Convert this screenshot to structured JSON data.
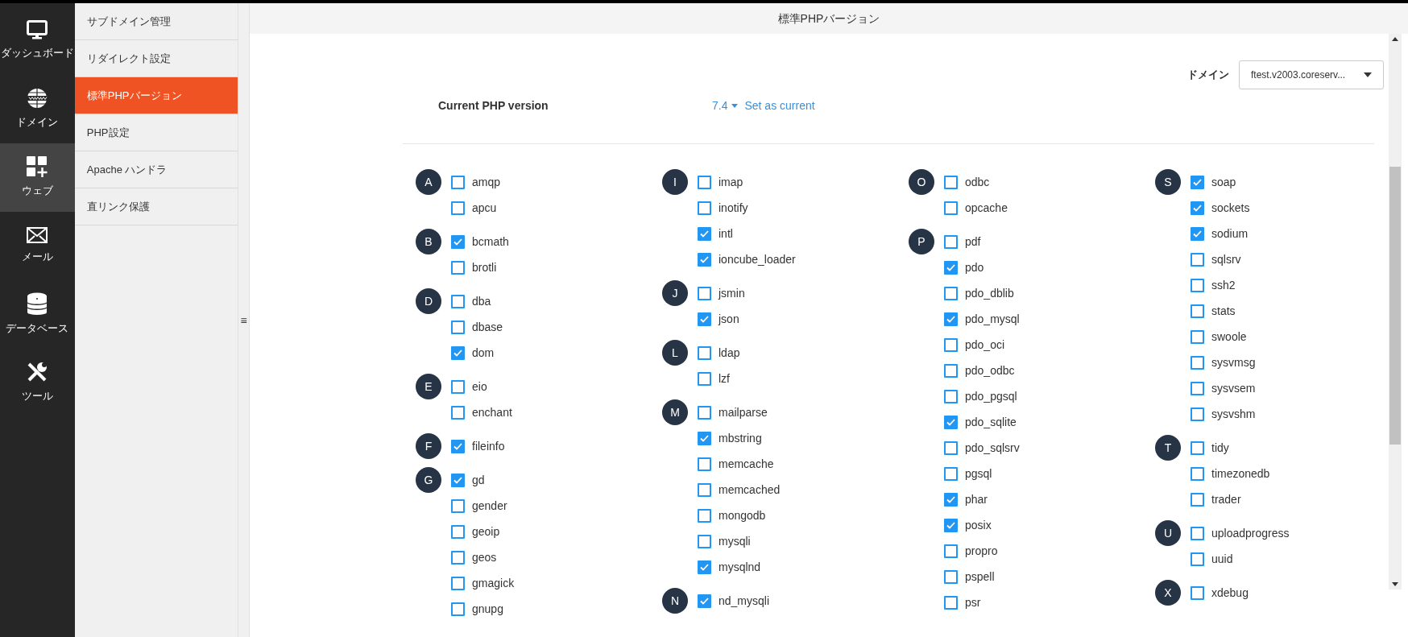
{
  "nav": [
    {
      "label": "ダッシュボード",
      "kind": "monitor",
      "selected": false
    },
    {
      "label": "ドメイン",
      "kind": "globe",
      "selected": false
    },
    {
      "label": "ウェブ",
      "kind": "grid",
      "selected": true
    },
    {
      "label": "メール",
      "kind": "mail",
      "selected": false
    },
    {
      "label": "データベース",
      "kind": "database",
      "selected": false
    },
    {
      "label": "ツール",
      "kind": "tools",
      "selected": false
    }
  ],
  "submenu": [
    {
      "label": "サブドメイン管理",
      "selected": false
    },
    {
      "label": "リダイレクト設定",
      "selected": false
    },
    {
      "label": "標準PHPバージョン",
      "selected": true
    },
    {
      "label": "PHP設定",
      "selected": false
    },
    {
      "label": "Apache ハンドラ",
      "selected": false
    },
    {
      "label": "直リンク保護",
      "selected": false
    }
  ],
  "collapse_handle": "≡",
  "page_title": "標準PHPバージョン",
  "domain": {
    "label": "ドメイン",
    "value": "ftest.v2003.coreserv..."
  },
  "php": {
    "label": "Current PHP version",
    "version": "7.4",
    "action": "Set as current"
  },
  "columns": [
    [
      {
        "letter": "A",
        "items": [
          {
            "name": "amqp",
            "checked": false
          },
          {
            "name": "apcu",
            "checked": false
          }
        ]
      },
      {
        "letter": "B",
        "items": [
          {
            "name": "bcmath",
            "checked": true
          },
          {
            "name": "brotli",
            "checked": false
          }
        ]
      },
      {
        "letter": "D",
        "items": [
          {
            "name": "dba",
            "checked": false
          },
          {
            "name": "dbase",
            "checked": false
          },
          {
            "name": "dom",
            "checked": true
          }
        ]
      },
      {
        "letter": "E",
        "items": [
          {
            "name": "eio",
            "checked": false
          },
          {
            "name": "enchant",
            "checked": false
          }
        ]
      },
      {
        "letter": "F",
        "items": [
          {
            "name": "fileinfo",
            "checked": true
          }
        ]
      },
      {
        "letter": "G",
        "items": [
          {
            "name": "gd",
            "checked": true
          },
          {
            "name": "gender",
            "checked": false
          },
          {
            "name": "geoip",
            "checked": false
          },
          {
            "name": "geos",
            "checked": false
          },
          {
            "name": "gmagick",
            "checked": false
          },
          {
            "name": "gnupg",
            "checked": false
          }
        ]
      }
    ],
    [
      {
        "letter": "I",
        "items": [
          {
            "name": "imap",
            "checked": false
          },
          {
            "name": "inotify",
            "checked": false
          },
          {
            "name": "intl",
            "checked": true
          },
          {
            "name": "ioncube_loader",
            "checked": true
          }
        ]
      },
      {
        "letter": "J",
        "items": [
          {
            "name": "jsmin",
            "checked": false
          },
          {
            "name": "json",
            "checked": true
          }
        ]
      },
      {
        "letter": "L",
        "items": [
          {
            "name": "ldap",
            "checked": false
          },
          {
            "name": "lzf",
            "checked": false
          }
        ]
      },
      {
        "letter": "M",
        "items": [
          {
            "name": "mailparse",
            "checked": false
          },
          {
            "name": "mbstring",
            "checked": true
          },
          {
            "name": "memcache",
            "checked": false
          },
          {
            "name": "memcached",
            "checked": false
          },
          {
            "name": "mongodb",
            "checked": false
          },
          {
            "name": "mysqli",
            "checked": false
          },
          {
            "name": "mysqlnd",
            "checked": true
          }
        ]
      },
      {
        "letter": "N",
        "items": [
          {
            "name": "nd_mysqli",
            "checked": true
          }
        ]
      }
    ],
    [
      {
        "letter": "O",
        "items": [
          {
            "name": "odbc",
            "checked": false
          },
          {
            "name": "opcache",
            "checked": false
          }
        ]
      },
      {
        "letter": "P",
        "items": [
          {
            "name": "pdf",
            "checked": false
          },
          {
            "name": "pdo",
            "checked": true
          },
          {
            "name": "pdo_dblib",
            "checked": false
          },
          {
            "name": "pdo_mysql",
            "checked": true
          },
          {
            "name": "pdo_oci",
            "checked": false
          },
          {
            "name": "pdo_odbc",
            "checked": false
          },
          {
            "name": "pdo_pgsql",
            "checked": false
          },
          {
            "name": "pdo_sqlite",
            "checked": true
          },
          {
            "name": "pdo_sqlsrv",
            "checked": false
          },
          {
            "name": "pgsql",
            "checked": false
          },
          {
            "name": "phar",
            "checked": true
          },
          {
            "name": "posix",
            "checked": true
          },
          {
            "name": "propro",
            "checked": false
          },
          {
            "name": "pspell",
            "checked": false
          },
          {
            "name": "psr",
            "checked": false
          }
        ]
      }
    ],
    [
      {
        "letter": "S",
        "items": [
          {
            "name": "soap",
            "checked": true
          },
          {
            "name": "sockets",
            "checked": true
          },
          {
            "name": "sodium",
            "checked": true
          },
          {
            "name": "sqlsrv",
            "checked": false
          },
          {
            "name": "ssh2",
            "checked": false
          },
          {
            "name": "stats",
            "checked": false
          },
          {
            "name": "swoole",
            "checked": false
          },
          {
            "name": "sysvmsg",
            "checked": false
          },
          {
            "name": "sysvsem",
            "checked": false
          },
          {
            "name": "sysvshm",
            "checked": false
          }
        ]
      },
      {
        "letter": "T",
        "items": [
          {
            "name": "tidy",
            "checked": false
          },
          {
            "name": "timezonedb",
            "checked": false
          },
          {
            "name": "trader",
            "checked": false
          }
        ]
      },
      {
        "letter": "U",
        "items": [
          {
            "name": "uploadprogress",
            "checked": false
          },
          {
            "name": "uuid",
            "checked": false
          }
        ]
      },
      {
        "letter": "X",
        "items": [
          {
            "name": "xdebug",
            "checked": false
          }
        ]
      }
    ]
  ]
}
